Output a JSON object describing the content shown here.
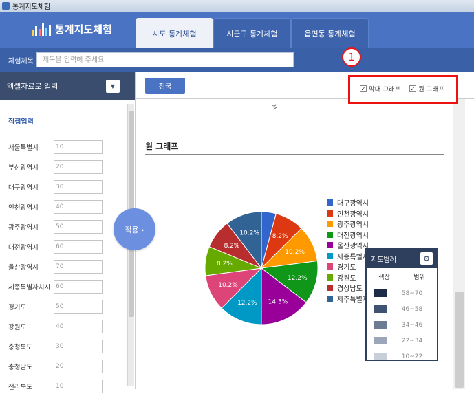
{
  "window": {
    "title": "통계지도체험"
  },
  "header": {
    "logo_text": "통계지도체험",
    "tabs": [
      {
        "label": "시도 통계체험",
        "active": true
      },
      {
        "label": "시군구 통계체험",
        "active": false
      },
      {
        "label": "읍면동 통계체험",
        "active": false
      }
    ]
  },
  "subbar": {
    "label": "체험제목",
    "placeholder": "제목을 입력해 주세요"
  },
  "sidebar": {
    "excel_label": "엑셀자료로 입력",
    "direct_label": "직접입력",
    "apply_label": "적용 ›",
    "rows": [
      {
        "label": "서울특별시",
        "value": "10"
      },
      {
        "label": "부산광역시",
        "value": "20"
      },
      {
        "label": "대구광역시",
        "value": "30"
      },
      {
        "label": "인천광역시",
        "value": "40"
      },
      {
        "label": "광주광역시",
        "value": "50"
      },
      {
        "label": "대전광역시",
        "value": "60"
      },
      {
        "label": "울산광역시",
        "value": "70"
      },
      {
        "label": "세종특별자치시",
        "value": "60"
      },
      {
        "label": "경기도",
        "value": "50"
      },
      {
        "label": "강원도",
        "value": "40"
      },
      {
        "label": "충청북도",
        "value": "30"
      },
      {
        "label": "충청남도",
        "value": "20"
      },
      {
        "label": "전라북도",
        "value": "10"
      }
    ]
  },
  "toolbar": {
    "all_label": "전국",
    "bar_chart_label": "막대 그래프",
    "pie_chart_label": "원 그래프",
    "bar_checked": true,
    "pie_checked": true
  },
  "annotation": {
    "marker": "1"
  },
  "chart_section": {
    "title": "원 그래프",
    "axis_tick": "서"
  },
  "chart_data": {
    "type": "pie",
    "legend_position": "right",
    "slices": [
      {
        "name": "대구광역시",
        "value": 4.1,
        "color": "#3366cc",
        "label": ""
      },
      {
        "name": "인천광역시",
        "value": 8.2,
        "color": "#dc3912",
        "label": "8.2%"
      },
      {
        "name": "광주광역시",
        "value": 10.2,
        "color": "#ff9900",
        "label": "10.2%"
      },
      {
        "name": "대전광역시",
        "value": 12.2,
        "color": "#109618",
        "label": "12.2%"
      },
      {
        "name": "울산광역시",
        "value": 14.3,
        "color": "#990099",
        "label": "14.3%"
      },
      {
        "name": "세종특별자치시",
        "value": 12.2,
        "color": "#0099c6",
        "label": "12.2%"
      },
      {
        "name": "경기도",
        "value": 10.2,
        "color": "#dd4477",
        "label": "10.2%"
      },
      {
        "name": "강원도",
        "value": 8.2,
        "color": "#66aa00",
        "label": "8.2%"
      },
      {
        "name": "경상남도",
        "value": 8.2,
        "color": "#b82e2e",
        "label": "8.2%"
      },
      {
        "name": "제주특별자치도",
        "value": 10.2,
        "color": "#316395",
        "label": "10.2%"
      }
    ],
    "legend_entries": [
      "대구광역시",
      "인천광역시",
      "광주광역시",
      "대전광역시",
      "울산광역시",
      "세종특별자",
      "경기도",
      "강원도",
      "경상남도",
      "제주특별자"
    ]
  },
  "map_legend": {
    "title": "지도범례",
    "col_color": "색상",
    "col_range": "범위",
    "rows": [
      {
        "range": "58~70",
        "color": "#1c2b47"
      },
      {
        "range": "46~58",
        "color": "#3f5273"
      },
      {
        "range": "34~46",
        "color": "#6d7c95"
      },
      {
        "range": "22~34",
        "color": "#9ba6b8"
      },
      {
        "range": "10~22",
        "color": "#c9cfd9"
      }
    ]
  }
}
